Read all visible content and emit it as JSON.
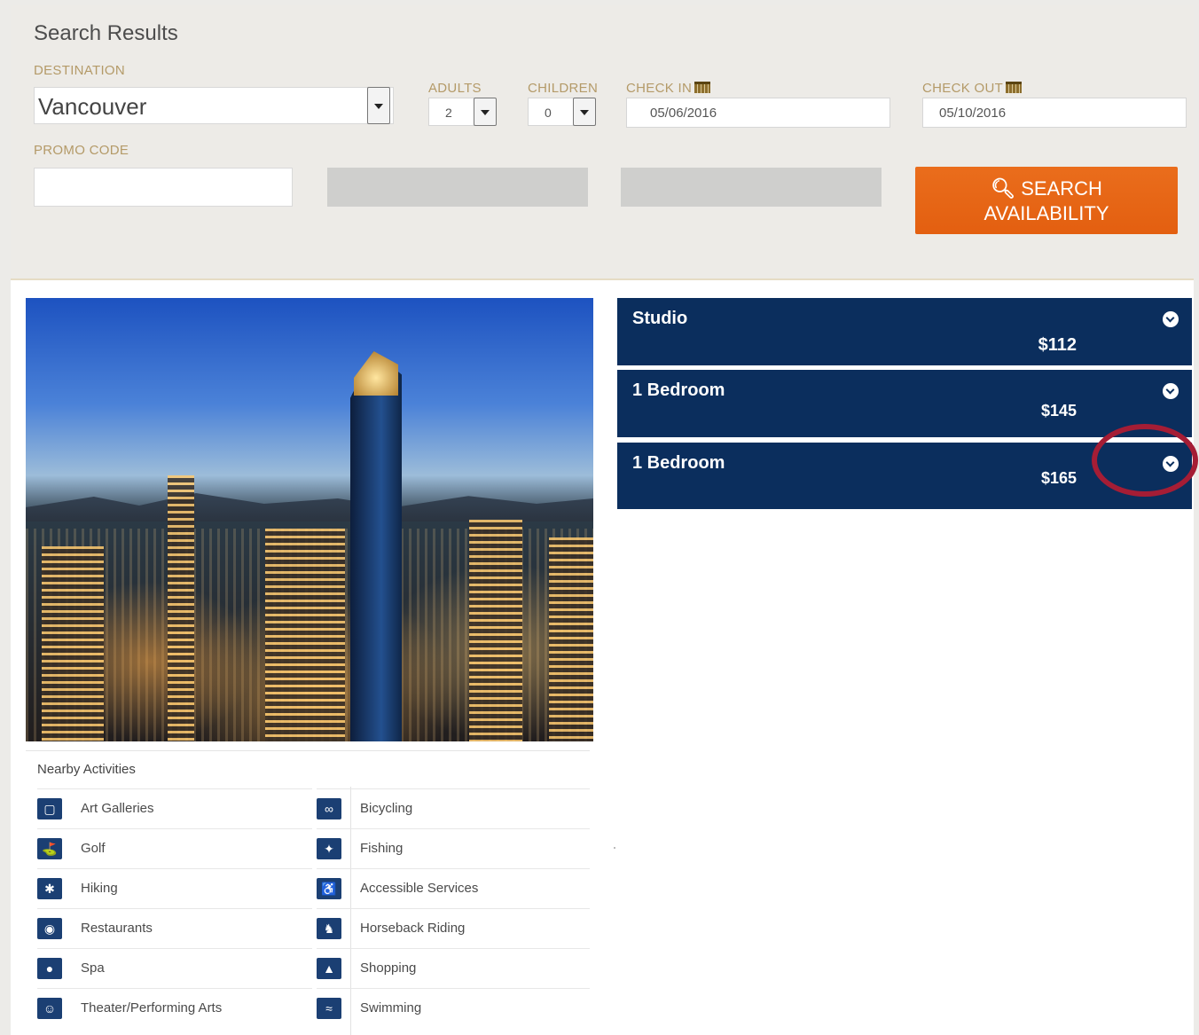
{
  "search": {
    "title": "Search Results",
    "destination_label": "DESTINATION",
    "destination_value": "Vancouver",
    "adults_label": "ADULTS",
    "adults_value": "2",
    "children_label": "CHILDREN",
    "children_value": "0",
    "checkin_label": "CHECK IN",
    "checkin_value": "05/06/2016",
    "checkout_label": "CHECK OUT",
    "checkout_value": "05/10/2016",
    "promo_label": "PROMO CODE",
    "promo_value": "",
    "button_line1": "SEARCH",
    "button_line2": "AVAILABILITY",
    "button_color": "#e8661a"
  },
  "rooms": [
    {
      "name": "Studio",
      "price": "$112"
    },
    {
      "name": "1 Bedroom",
      "price": "$145"
    },
    {
      "name": "1 Bedroom",
      "price": "$165"
    }
  ],
  "activities": {
    "title": "Nearby Activities",
    "left": [
      {
        "label": "Art Galleries",
        "icon": "frame-icon"
      },
      {
        "label": "Golf",
        "icon": "golf-icon"
      },
      {
        "label": "Hiking",
        "icon": "hiker-icon"
      },
      {
        "label": "Restaurants",
        "icon": "plate-icon"
      },
      {
        "label": "Spa",
        "icon": "drop-icon"
      },
      {
        "label": "Theater/Performing Arts",
        "icon": "masks-icon"
      }
    ],
    "right": [
      {
        "label": "Bicycling",
        "icon": "bicycle-icon"
      },
      {
        "label": "Fishing",
        "icon": "fish-icon"
      },
      {
        "label": "Accessible Services",
        "icon": "wheelchair-icon"
      },
      {
        "label": "Horseback Riding",
        "icon": "horse-icon"
      },
      {
        "label": "Shopping",
        "icon": "shop-icon"
      },
      {
        "label": "Swimming",
        "icon": "swimmer-icon"
      }
    ]
  },
  "colors": {
    "room_bar": "#0b2e5d",
    "highlight": "#a51d35",
    "label_gold": "#b49a68"
  }
}
